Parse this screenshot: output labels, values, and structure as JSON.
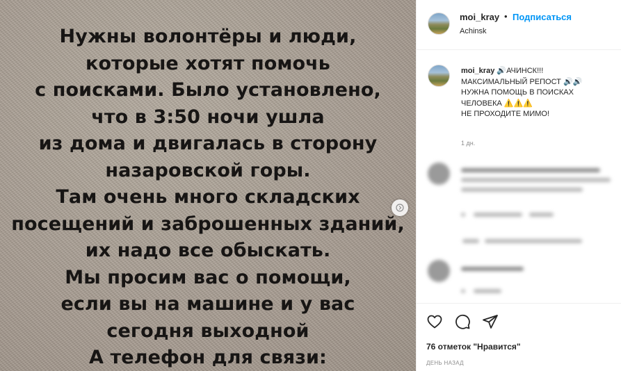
{
  "post": {
    "image_text_lines": [
      "Нужны волонтёры и люди,",
      "которые хотят помочь",
      "с поисками. Было установлено,",
      "что в 3:50 ночи ушла",
      "из дома и двигалась в сторону",
      "назаровской горы.",
      "Там очень много складских",
      "посещений и заброшенных зданий,",
      "их надо все обыскать.",
      "Мы просим вас о помощи,",
      "если вы на машине и у вас",
      "сегодня выходной",
      "А телефон для связи:"
    ]
  },
  "header": {
    "username": "moi_kray",
    "dot": "•",
    "follow_label": "Подписаться",
    "location": "Achinsk"
  },
  "caption": {
    "username": "moi_kray",
    "line1_rest": "🔊АЧИНСК!!!",
    "line2": "МАКСИМАЛЬНЫЙ РЕПОСТ 🔊🔊",
    "line3": "НУЖНА ПОМОЩЬ В ПОИСКАХ",
    "line4": "ЧЕЛОВЕКА ⚠️⚠️⚠️",
    "line5": "НЕ ПРОХОДИТЕ МИМО!",
    "time": "1 дн."
  },
  "actions": {
    "likes_text": "76 отметок \"Нравится\"",
    "date_text": "ДЕНЬ НАЗАД"
  },
  "icons": [
    "chevron-right-icon",
    "heart-icon",
    "comment-icon",
    "share-icon"
  ],
  "colors": {
    "link": "#0095f6",
    "text": "#262626",
    "muted": "#8e8e8e"
  }
}
